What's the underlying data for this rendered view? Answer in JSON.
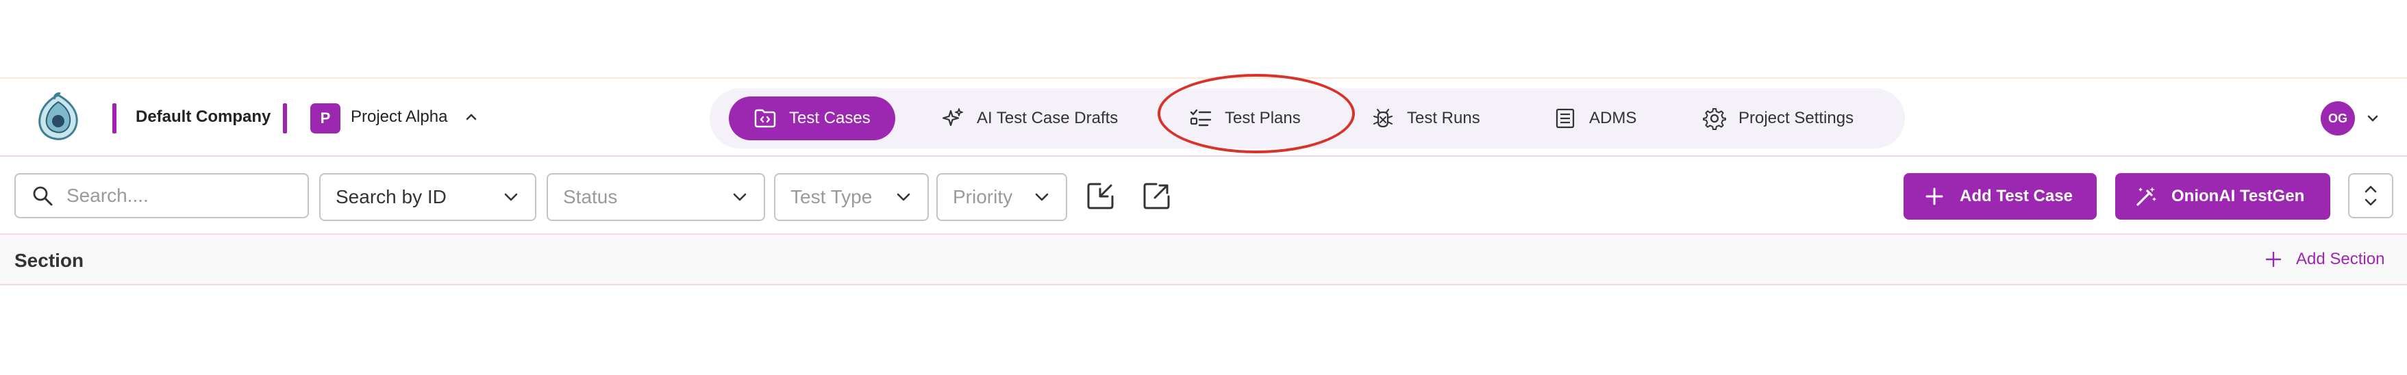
{
  "header": {
    "company": "Default Company",
    "project_badge": "P",
    "project_name": "Project Alpha",
    "user_initials": "OG",
    "nav": [
      {
        "label": "Test Cases",
        "icon": "folder-code-icon",
        "active": true
      },
      {
        "label": "AI Test Case Drafts",
        "icon": "sparkles-icon",
        "active": false
      },
      {
        "label": "Test Plans",
        "icon": "checklist-icon",
        "active": false,
        "highlighted": true
      },
      {
        "label": "Test Runs",
        "icon": "bug-icon",
        "active": false
      },
      {
        "label": "ADMS",
        "icon": "document-list-icon",
        "active": false
      },
      {
        "label": "Project Settings",
        "icon": "gear-icon",
        "active": false
      }
    ]
  },
  "toolbar": {
    "search_placeholder": "Search....",
    "search_by": "Search by ID",
    "status_placeholder": "Status",
    "test_type_placeholder": "Test Type",
    "priority_placeholder": "Priority",
    "add_test_case": "Add Test Case",
    "onionai_testgen": "OnionAI TestGen"
  },
  "section": {
    "title": "Section",
    "add_section": "Add Section"
  },
  "colors": {
    "accent": "#9c27b0",
    "highlight_ring": "#d8322b",
    "nav_background": "#f4f2f8"
  }
}
